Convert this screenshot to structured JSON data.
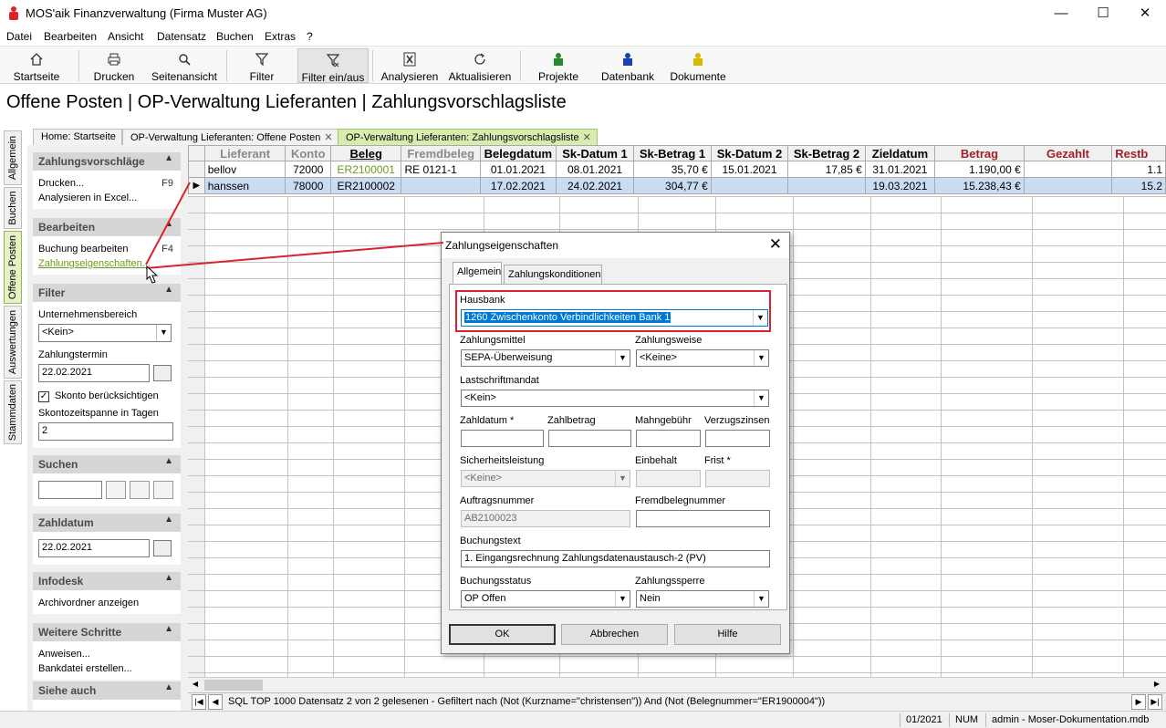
{
  "window": {
    "title": "MOS'aik Finanzverwaltung (Firma Muster AG)",
    "min": "—",
    "max": "☐",
    "close": "✕"
  },
  "menu": [
    "Datei",
    "Bearbeiten",
    "Ansicht",
    "Datensatz",
    "Buchen",
    "Extras",
    "?"
  ],
  "toolbar": {
    "startseite": "Startseite",
    "drucken": "Drucken",
    "seitenansicht": "Seitenansicht",
    "filter": "Filter",
    "filter_toggle": "Filter ein/aus",
    "analysieren": "Analysieren",
    "aktualisieren": "Aktualisieren",
    "projekte": "Projekte",
    "datenbank": "Datenbank",
    "dokumente": "Dokumente"
  },
  "page_title": "Offene Posten | OP-Verwaltung Lieferanten | Zahlungsvorschlagsliste",
  "vtabs": [
    "Allgemein",
    "Buchen",
    "Offene Posten",
    "Auswertungen",
    "Stammdaten"
  ],
  "tabs": [
    "Home: Startseite",
    "OP-Verwaltung Lieferanten: Offene Posten",
    "OP-Verwaltung Lieferanten: Zahlungsvorschlagsliste"
  ],
  "tab_close": "✕",
  "taskpane": {
    "zv": {
      "title": "Zahlungsvorschläge",
      "drucken": "Drucken...",
      "drucken_key": "F9",
      "analysieren": "Analysieren in Excel..."
    },
    "bearbeiten": {
      "title": "Bearbeiten",
      "buchung": "Buchung bearbeiten",
      "buchung_key": "F4",
      "zahlungseig": "Zahlungseigenschaften..."
    },
    "filter": {
      "title": "Filter",
      "unternehmensbereich_label": "Unternehmensbereich",
      "unternehmensbereich": "<Kein>",
      "zahlungstermin_label": "Zahlungstermin",
      "zahlungstermin": "22.02.2021",
      "skonto_label": "Skonto berücksichtigen",
      "skontozeitspanne_label": "Skontozeitspanne in Tagen",
      "skontozeitspanne": "2"
    },
    "suchen": {
      "title": "Suchen",
      "value": ""
    },
    "zahldatum": {
      "title": "Zahldatum",
      "value": "22.02.2021"
    },
    "infodesk": {
      "title": "Infodesk",
      "archiv": "Archivordner anzeigen"
    },
    "weitere": {
      "title": "Weitere Schritte",
      "anweisen": "Anweisen...",
      "bankdatei": "Bankdatei erstellen..."
    },
    "siehe": {
      "title": "Siehe auch"
    }
  },
  "grid": {
    "columns": [
      "Lieferant",
      "Konto",
      "Beleg",
      "Fremdbeleg",
      "Belegdatum",
      "Sk-Datum 1",
      "Sk-Betrag 1",
      "Sk-Datum 2",
      "Sk-Betrag 2",
      "Zieldatum",
      "Betrag",
      "Gezahlt",
      "Restb"
    ],
    "rows": [
      [
        "bellov",
        "72000",
        "ER2100001",
        "RE 0121-1",
        "01.01.2021",
        "08.01.2021",
        "35,70 €",
        "15.01.2021",
        "17,85 €",
        "31.01.2021",
        "1.190,00 €",
        "",
        "1.1"
      ],
      [
        "hanssen",
        "78000",
        "ER2100002",
        "",
        "17.02.2021",
        "24.02.2021",
        "304,77 €",
        "",
        "",
        "19.03.2021",
        "15.238,43 €",
        "",
        "15.2"
      ]
    ]
  },
  "navbar": {
    "text": "SQL TOP 1000 Datensatz 2 von 2 gelesenen - Gefiltert nach (Not (Kurzname=\"christensen\")) And (Not (Belegnummer=\"ER1900004\"))"
  },
  "statusbar": {
    "period": "01/2021",
    "num": "NUM",
    "user": "admin - Moser-Dokumentation.mdb"
  },
  "dialog": {
    "title": "Zahlungseigenschaften",
    "tabs": [
      "Allgemein",
      "Zahlungskonditionen"
    ],
    "hausbank_label": "Hausbank",
    "hausbank": "1260 Zwischenkonto Verbindlichkeiten Bank 1",
    "zahlungsmittel_label": "Zahlungsmittel",
    "zahlungsmittel": "SEPA-Überweisung",
    "zahlungsweise_label": "Zahlungsweise",
    "zahlungsweise": "<Keine>",
    "lastschriftmandat_label": "Lastschriftmandat",
    "lastschriftmandat": "<Kein>",
    "zahldatum_label": "Zahldatum *",
    "zahlbetrag_label": "Zahlbetrag",
    "mahngebuehr_label": "Mahngebühr",
    "verzugszinsen_label": "Verzugszinsen",
    "sicherheitsleistung_label": "Sicherheitsleistung",
    "sicherheitsleistung": "<Keine>",
    "einbehalt_label": "Einbehalt",
    "frist_label": "Frist *",
    "auftragsnummer_label": "Auftragsnummer",
    "auftragsnummer": "AB2100023",
    "fremdbelegnummer_label": "Fremdbelegnummer",
    "buchungstext_label": "Buchungstext",
    "buchungstext": "1. Eingangsrechnung Zahlungsdatenaustausch-2 (PV)",
    "buchungsstatus_label": "Buchungsstatus",
    "buchungsstatus": "OP Offen",
    "zahlungssperre_label": "Zahlungssperre",
    "zahlungssperre": "Nein",
    "ok": "OK",
    "abbrechen": "Abbrechen",
    "hilfe": "Hilfe"
  },
  "colors": {
    "accent_green": "#6a9c1d",
    "highlight_red": "#d9232e",
    "selection": "#c9dcf2",
    "red_header": "#a0202a"
  }
}
